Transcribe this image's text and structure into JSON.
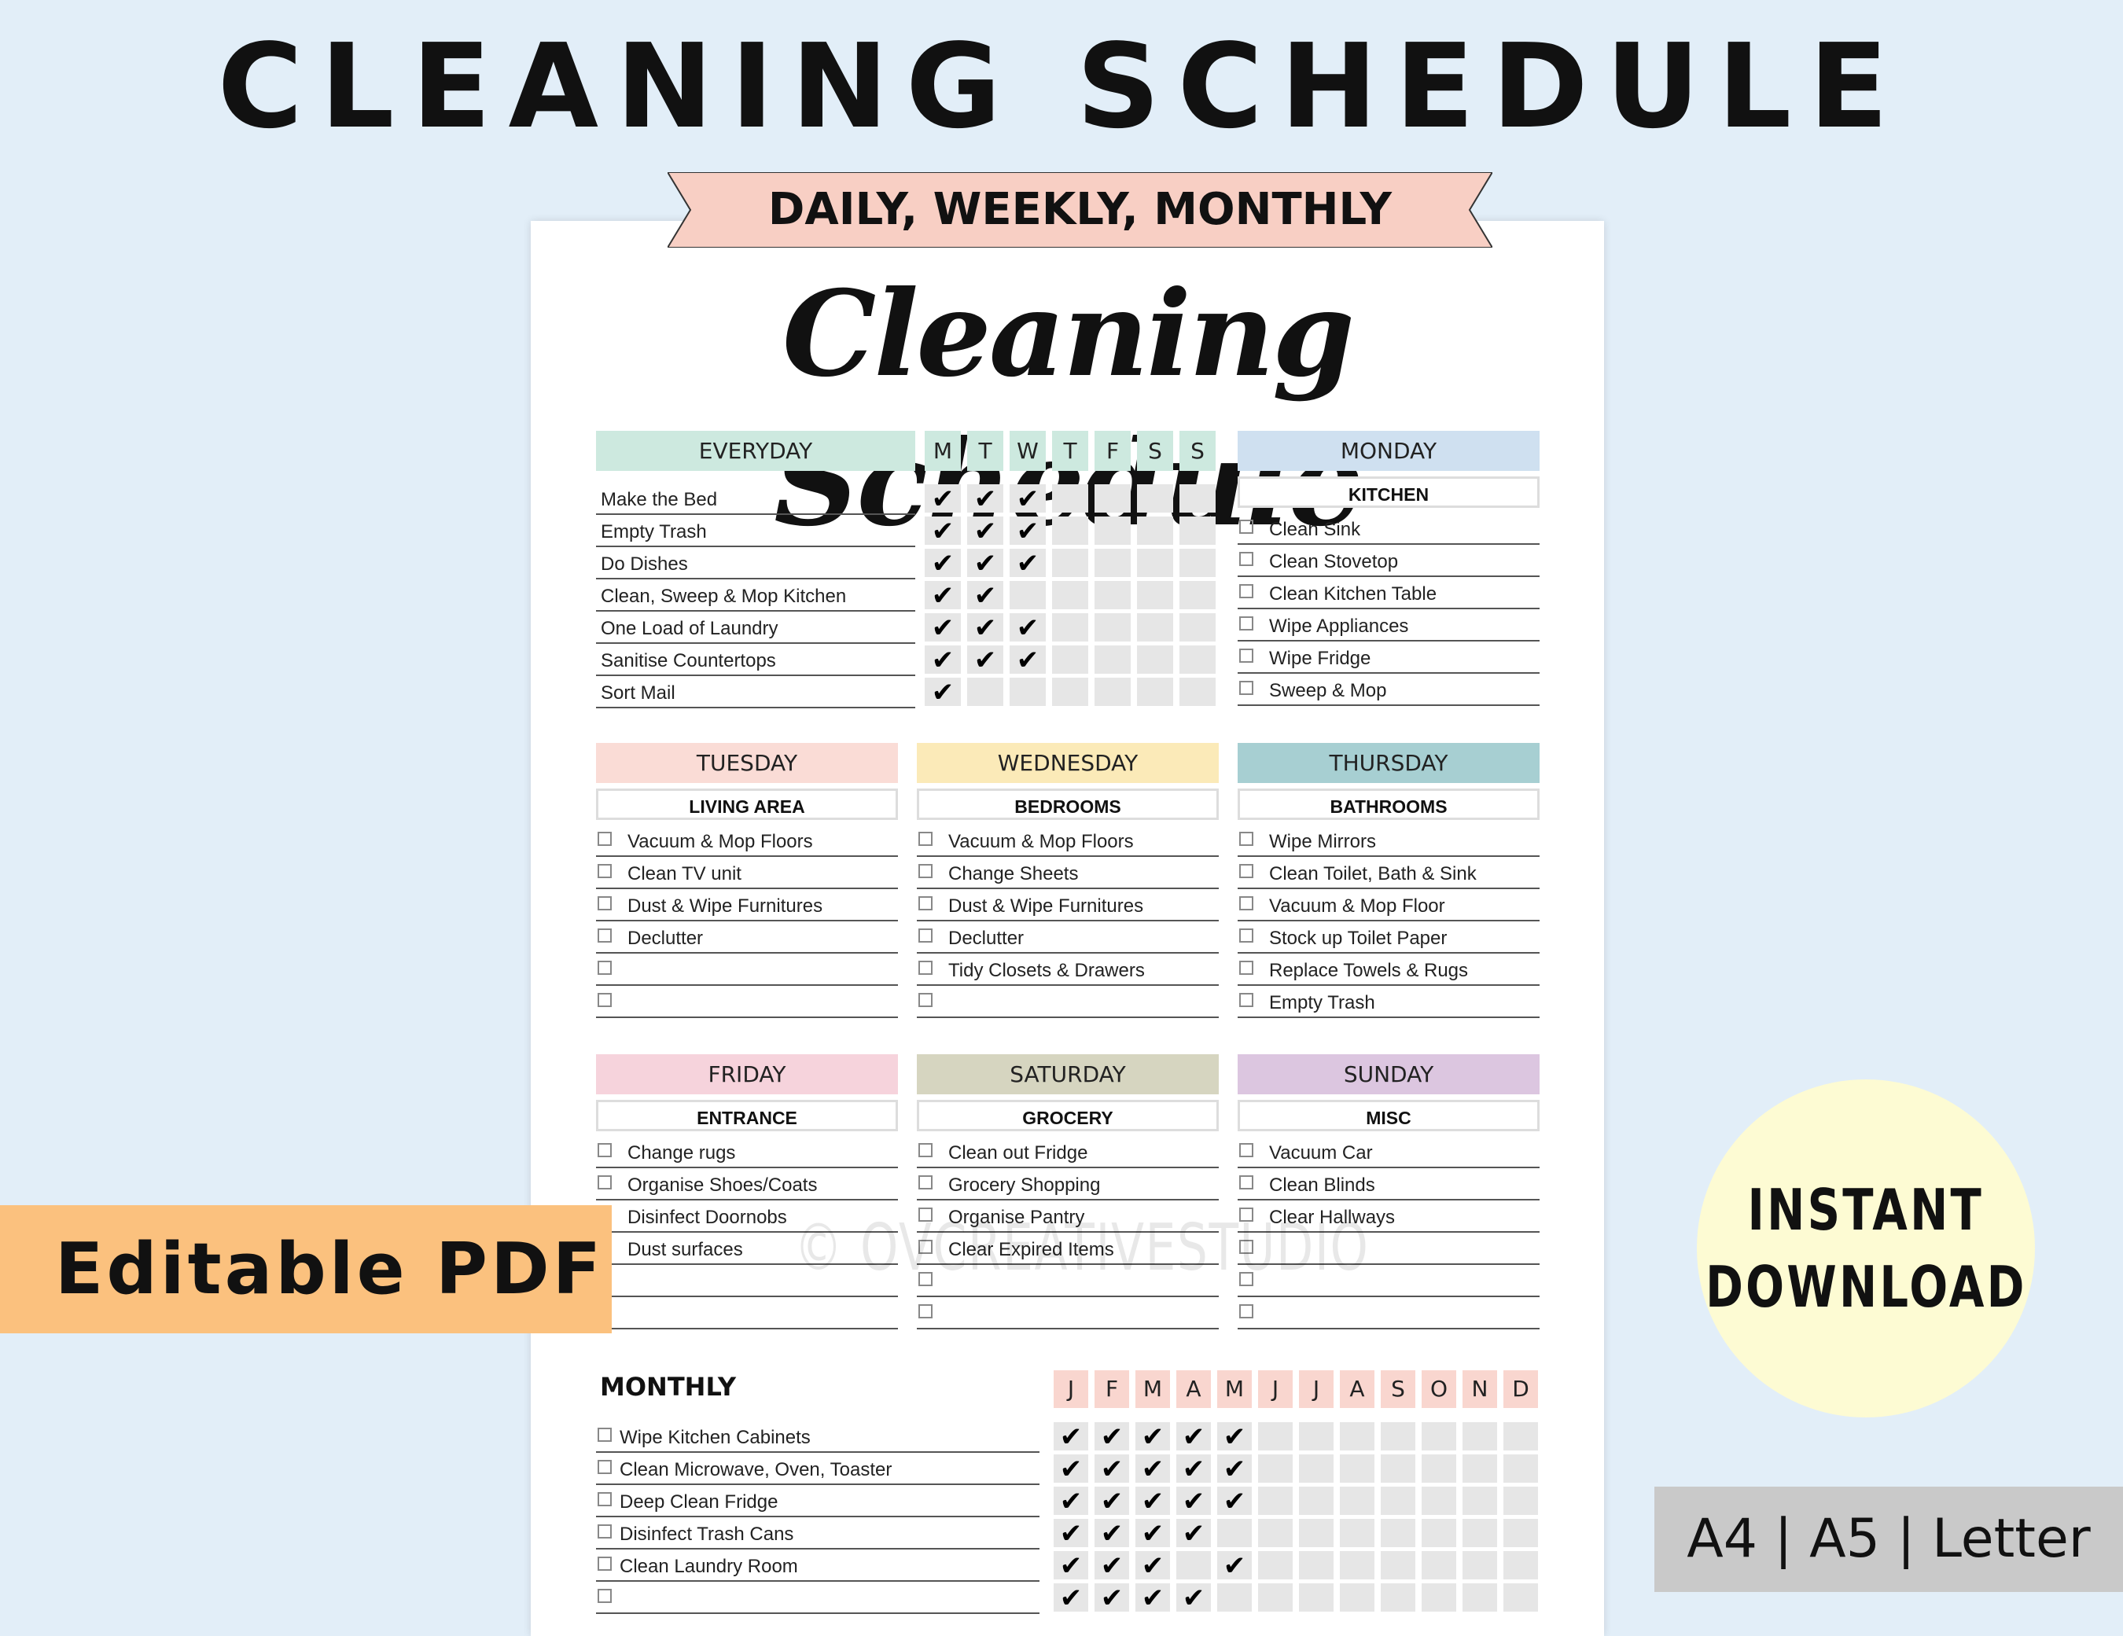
{
  "banner_title": "CLEANING SCHEDULE",
  "ribbon": "DAILY, WEEKLY, MONTHLY",
  "script_title": "Cleaning Schedule",
  "colors": {
    "background": "#e2eef8",
    "everyday": "#cde9df",
    "monday": "#cfe0f0",
    "tuesday": "#fadcd6",
    "wednesday": "#fbeab8",
    "thursday": "#a7cfd2",
    "friday": "#f6d3dc",
    "saturday": "#d6d5c0",
    "sunday": "#dcc6e0",
    "months": "#f9d6cf",
    "ribbon": "#f8cfc4",
    "pdf_banner": "#fbc17e",
    "instant_badge": "#fdfbd3"
  },
  "everyday": {
    "title": "EVERYDAY",
    "days": [
      "M",
      "T",
      "W",
      "T",
      "F",
      "S",
      "S"
    ],
    "items": [
      {
        "label": "Make the Bed",
        "checks": [
          1,
          1,
          1,
          0,
          0,
          0,
          0
        ]
      },
      {
        "label": "Empty Trash",
        "checks": [
          1,
          1,
          1,
          0,
          0,
          0,
          0
        ]
      },
      {
        "label": "Do Dishes",
        "checks": [
          1,
          1,
          1,
          0,
          0,
          0,
          0
        ]
      },
      {
        "label": "Clean, Sweep & Mop Kitchen",
        "checks": [
          1,
          1,
          0,
          0,
          0,
          0,
          0
        ]
      },
      {
        "label": "One Load of Laundry",
        "checks": [
          1,
          1,
          1,
          0,
          0,
          0,
          0
        ]
      },
      {
        "label": "Sanitise Countertops",
        "checks": [
          1,
          1,
          1,
          0,
          0,
          0,
          0
        ]
      },
      {
        "label": "Sort Mail",
        "checks": [
          1,
          0,
          0,
          0,
          0,
          0,
          0
        ]
      }
    ]
  },
  "days": [
    {
      "key": "monday",
      "title": "MONDAY",
      "area": "KITCHEN",
      "items": [
        "Clean Sink",
        "Clean Stovetop",
        "Clean Kitchen Table",
        "Wipe Appliances",
        "Wipe Fridge",
        "Sweep & Mop"
      ]
    },
    {
      "key": "tuesday",
      "title": "TUESDAY",
      "area": "LIVING AREA",
      "items": [
        "Vacuum & Mop Floors",
        "Clean TV unit",
        "Dust & Wipe Furnitures",
        "Declutter",
        "",
        ""
      ]
    },
    {
      "key": "wednesday",
      "title": "WEDNESDAY",
      "area": "BEDROOMS",
      "items": [
        "Vacuum & Mop Floors",
        "Change Sheets",
        "Dust & Wipe Furnitures",
        "Declutter",
        "Tidy Closets & Drawers",
        ""
      ]
    },
    {
      "key": "thursday",
      "title": "THURSDAY",
      "area": "BATHROOMS",
      "items": [
        "Wipe Mirrors",
        "Clean Toilet, Bath & Sink",
        "Vacuum & Mop Floor",
        "Stock up Toilet Paper",
        "Replace Towels & Rugs",
        "Empty Trash"
      ]
    },
    {
      "key": "friday",
      "title": "FRIDAY",
      "area": "ENTRANCE",
      "items": [
        "Change rugs",
        "Organise Shoes/Coats",
        "Disinfect Doornobs",
        "Dust surfaces",
        "",
        ""
      ]
    },
    {
      "key": "saturday",
      "title": "SATURDAY",
      "area": "GROCERY",
      "items": [
        "Clean out Fridge",
        "Grocery Shopping",
        "Organise Pantry",
        "Clear Expired Items",
        "",
        ""
      ]
    },
    {
      "key": "sunday",
      "title": "SUNDAY",
      "area": "MISC",
      "items": [
        "Vacuum Car",
        "Clean Blinds",
        "Clear Hallways",
        "",
        "",
        ""
      ]
    }
  ],
  "monthly": {
    "title": "MONTHLY",
    "months": [
      "J",
      "F",
      "M",
      "A",
      "M",
      "J",
      "J",
      "A",
      "S",
      "O",
      "N",
      "D"
    ],
    "items": [
      {
        "label": "Wipe Kitchen Cabinets",
        "checks": [
          1,
          1,
          1,
          1,
          1,
          0,
          0,
          0,
          0,
          0,
          0,
          0
        ]
      },
      {
        "label": "Clean Microwave, Oven, Toaster",
        "checks": [
          1,
          1,
          1,
          1,
          1,
          0,
          0,
          0,
          0,
          0,
          0,
          0
        ]
      },
      {
        "label": "Deep Clean Fridge",
        "checks": [
          1,
          1,
          1,
          1,
          1,
          0,
          0,
          0,
          0,
          0,
          0,
          0
        ]
      },
      {
        "label": "Disinfect Trash Cans",
        "checks": [
          1,
          1,
          1,
          1,
          0,
          0,
          0,
          0,
          0,
          0,
          0,
          0
        ]
      },
      {
        "label": "Clean Laundry Room",
        "checks": [
          1,
          1,
          1,
          0,
          1,
          0,
          0,
          0,
          0,
          0,
          0,
          0
        ]
      },
      {
        "label": "",
        "checks": [
          1,
          1,
          1,
          1,
          0,
          0,
          0,
          0,
          0,
          0,
          0,
          0
        ]
      }
    ]
  },
  "watermark": "© OVCREATIVESTUDIO",
  "editable_label": "Editable PDF",
  "instant_download": [
    "INSTANT",
    "DOWNLOAD"
  ],
  "formats": "A4 | A5 | Letter",
  "check_glyph": "✔"
}
